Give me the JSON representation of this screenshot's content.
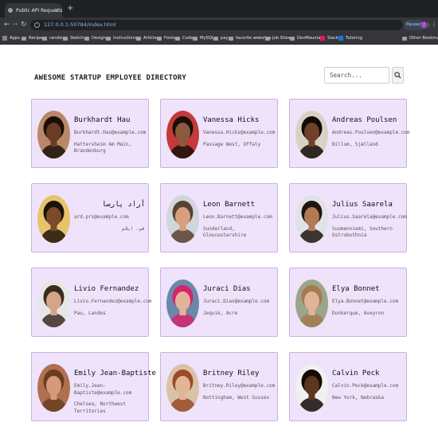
{
  "browser": {
    "tab_title": "Public API Requests",
    "tab_close": "×",
    "new_tab": "+",
    "url": "127.0.0.1:50784/index.html",
    "paused_label": "Paused",
    "profile_initial": "J",
    "bookmarks": [
      "Apps",
      "Recipes",
      "random",
      "Sketch",
      "Design",
      "Instructions",
      "Articles",
      "Fonts",
      "Code",
      "MySQL",
      "pay",
      "favorite websites",
      "Job Sites",
      "DevMountain",
      "Slack",
      "Tutoring",
      "Other Bookmarks"
    ]
  },
  "page": {
    "title": "AWESOME STARTUP EMPLOYEE DIRECTORY",
    "search_placeholder": "Search..."
  },
  "employees": [
    {
      "name": "Burkhardt Hau",
      "email": "Burkhardt.Hau@example.com",
      "location": "Hattersheim Am Main, Brandenburg",
      "skin": "#6b3b24",
      "hair": "#1a1008",
      "bg": "#b9876a"
    },
    {
      "name": "Vanessa Hicks",
      "email": "Vanessa.Hicks@example.com",
      "location": "Passage West, Offaly",
      "skin": "#8a5a3c",
      "hair": "#1c0f08",
      "bg": "#c23a3a"
    },
    {
      "name": "Andreas Poulsen",
      "email": "Andreas.Poulsen@example.com",
      "location": "Billum, Sjælland",
      "skin": "#6e4129",
      "hair": "#120a06",
      "bg": "#d9d2c4"
    },
    {
      "name": "آراد پارسا",
      "email": "ard.prs@example.com",
      "location": "قم، ایلام",
      "skin": "#7b4a2b",
      "hair": "#1b120b",
      "bg": "#e7c36b"
    },
    {
      "name": "Leon Barnett",
      "email": "Leon.Barnett@example.com",
      "location": "Sunderland, Gloucestershire",
      "skin": "#d5a07e",
      "hair": "#5a4030",
      "bg": "#cfd6dc"
    },
    {
      "name": "Julius Saarela",
      "email": "Julius.Saarela@example.com",
      "location": "Suomenniemi, Southern Ostrobothnia",
      "skin": "#b07a55",
      "hair": "#1e150e",
      "bg": "#dfe3e6"
    },
    {
      "name": "Livio Fernandez",
      "email": "Livio.Fernandez@example.com",
      "location": "Pau, Landes",
      "skin": "#d6a488",
      "hair": "#3a2a20",
      "bg": "#e6e6e6"
    },
    {
      "name": "Juraci Dias",
      "email": "Juraci.Dias@example.com",
      "location": "Jequié, Acre",
      "skin": "#e2b39a",
      "hair": "#d6246e",
      "bg": "#6b88a8"
    },
    {
      "name": "Elya Bonnet",
      "email": "Elya.Bonnet@example.com",
      "location": "Dunkerque, Aveyron",
      "skin": "#e0b396",
      "hair": "#a57a4e",
      "bg": "#9aa58a"
    },
    {
      "name": "Emily Jean-Baptiste",
      "email": "Emily.Jean-Baptiste@example.com",
      "location": "Chelsea, Northwest Territories",
      "skin": "#d49a7a",
      "hair": "#6a3d22",
      "bg": "#b07050"
    },
    {
      "name": "Britney Riley",
      "email": "Britney.Riley@example.com",
      "location": "Nottingham, West Sussex",
      "skin": "#e3b597",
      "hair": "#9a4a28",
      "bg": "#d8c3a8"
    },
    {
      "name": "Calvin Peck",
      "email": "Calvin.Peck@example.com",
      "location": "New York, Nebraska",
      "skin": "#5b3620",
      "hair": "#120a06",
      "bg": "#f0f0f0"
    }
  ]
}
